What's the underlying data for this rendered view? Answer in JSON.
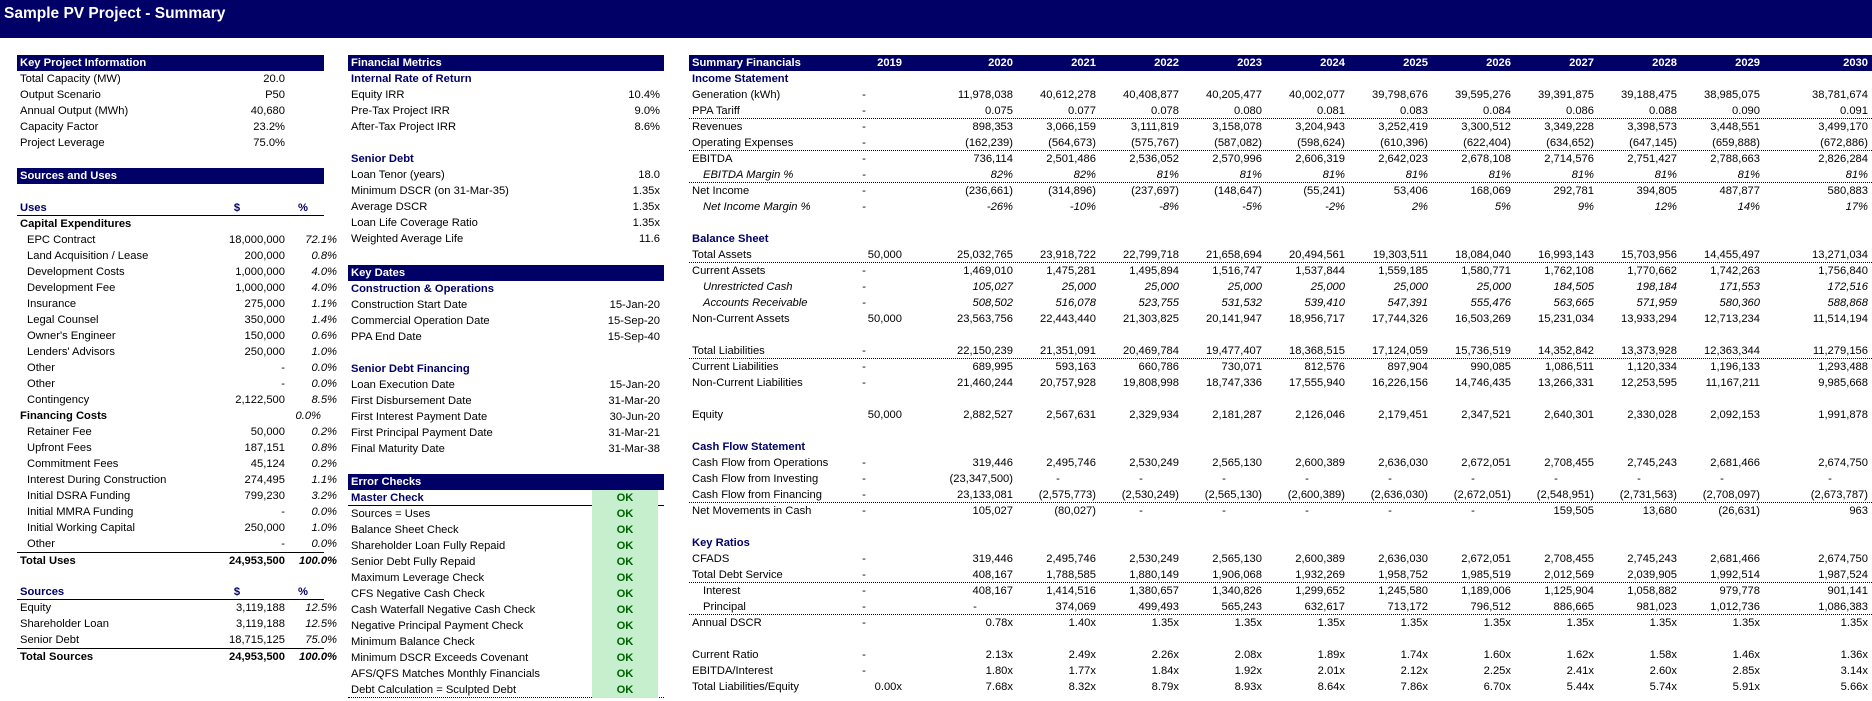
{
  "page_title": "Sample PV Project - Summary",
  "key_info": {
    "header": "Key Project Information",
    "rows": [
      {
        "label": "Total Capacity (MW)",
        "value": "20.0"
      },
      {
        "label": "Output Scenario",
        "value": "P50"
      },
      {
        "label": "Annual Output (MWh)",
        "value": "40,680"
      },
      {
        "label": "Capacity Factor",
        "value": "23.2%"
      },
      {
        "label": "Project Leverage",
        "value": "75.0%"
      }
    ]
  },
  "sources_uses": {
    "header": "Sources and Uses",
    "uses_label": "Uses",
    "uses_col1": "$",
    "uses_col2": "%",
    "capex_label": "Capital Expenditures",
    "capex": [
      {
        "label": "EPC Contract",
        "amount": "18,000,000",
        "pct": "72.1%"
      },
      {
        "label": "Land Acquisition / Lease",
        "amount": "200,000",
        "pct": "0.8%"
      },
      {
        "label": "Development Costs",
        "amount": "1,000,000",
        "pct": "4.0%"
      },
      {
        "label": "Development Fee",
        "amount": "1,000,000",
        "pct": "4.0%"
      },
      {
        "label": "Insurance",
        "amount": "275,000",
        "pct": "1.1%"
      },
      {
        "label": "Legal Counsel",
        "amount": "350,000",
        "pct": "1.4%"
      },
      {
        "label": "Owner's Engineer",
        "amount": "150,000",
        "pct": "0.6%"
      },
      {
        "label": "Lenders' Advisors",
        "amount": "250,000",
        "pct": "1.0%"
      },
      {
        "label": "Other",
        "amount": "-",
        "pct": "0.0%"
      },
      {
        "label": "Other",
        "amount": "-",
        "pct": "0.0%"
      },
      {
        "label": "Contingency",
        "amount": "2,122,500",
        "pct": "8.5%"
      }
    ],
    "fin_label": "Financing Costs",
    "fin_pct": "0.0%",
    "fin": [
      {
        "label": "Retainer Fee",
        "amount": "50,000",
        "pct": "0.2%"
      },
      {
        "label": "Upfront Fees",
        "amount": "187,151",
        "pct": "0.8%"
      },
      {
        "label": "Commitment Fees",
        "amount": "45,124",
        "pct": "0.2%"
      },
      {
        "label": "Interest During Construction",
        "amount": "274,495",
        "pct": "1.1%"
      },
      {
        "label": "Initial DSRA Funding",
        "amount": "799,230",
        "pct": "3.2%"
      },
      {
        "label": "Initial MMRA Funding",
        "amount": "-",
        "pct": "0.0%"
      },
      {
        "label": "Initial Working Capital",
        "amount": "250,000",
        "pct": "1.0%"
      },
      {
        "label": "Other",
        "amount": "-",
        "pct": "0.0%"
      }
    ],
    "total_uses": {
      "label": "Total Uses",
      "amount": "24,953,500",
      "pct": "100.0%"
    },
    "sources_label": "Sources",
    "sources_col1": "$",
    "sources_col2": "%",
    "sources": [
      {
        "label": "Equity",
        "amount": "3,119,188",
        "pct": "12.5%"
      },
      {
        "label": "Shareholder Loan",
        "amount": "3,119,188",
        "pct": "12.5%"
      },
      {
        "label": "Senior Debt",
        "amount": "18,715,125",
        "pct": "75.0%"
      }
    ],
    "total_sources": {
      "label": "Total Sources",
      "amount": "24,953,500",
      "pct": "100.0%"
    }
  },
  "financial_metrics": {
    "header": "Financial Metrics",
    "irr_label": "Internal Rate of Return",
    "irr": [
      {
        "label": "Equity IRR",
        "value": "10.4%"
      },
      {
        "label": "Pre-Tax Project IRR",
        "value": "9.0%"
      },
      {
        "label": "After-Tax Project IRR",
        "value": "8.6%"
      }
    ],
    "debt_label": "Senior Debt",
    "debt": [
      {
        "label": "Loan Tenor (years)",
        "value": "18.0"
      },
      {
        "label": "Minimum DSCR (on 31-Mar-35)",
        "value": "1.35x"
      },
      {
        "label": "Average DSCR",
        "value": "1.35x"
      },
      {
        "label": "Loan Life Coverage Ratio",
        "value": "1.35x"
      },
      {
        "label": "Weighted Average Life",
        "value": "11.6"
      }
    ]
  },
  "key_dates": {
    "header": "Key Dates",
    "construction_label": "Construction & Operations",
    "construction": [
      {
        "label": "Construction Start Date",
        "value": "15-Jan-20"
      },
      {
        "label": "Commercial Operation Date",
        "value": "15-Sep-20"
      },
      {
        "label": "PPA End Date",
        "value": "15-Sep-40"
      }
    ],
    "financing_label": "Senior Debt Financing",
    "financing": [
      {
        "label": "Loan Execution Date",
        "value": "15-Jan-20"
      },
      {
        "label": "First Disbursement Date",
        "value": "31-Mar-20"
      },
      {
        "label": "First Interest Payment Date",
        "value": "30-Jun-20"
      },
      {
        "label": "First Principal Payment Date",
        "value": "31-Mar-21"
      },
      {
        "label": "Final Maturity Date",
        "value": "31-Mar-38"
      }
    ]
  },
  "error_checks": {
    "header": "Error Checks",
    "master_label": "Master Check",
    "master_status": "OK",
    "checks": [
      {
        "label": "Sources = Uses",
        "status": "OK"
      },
      {
        "label": "Balance Sheet Check",
        "status": "OK"
      },
      {
        "label": "Shareholder Loan Fully Repaid",
        "status": "OK"
      },
      {
        "label": "Senior Debt Fully Repaid",
        "status": "OK"
      },
      {
        "label": "Maximum Leverage Check",
        "status": "OK"
      },
      {
        "label": "CFS Negative Cash Check",
        "status": "OK"
      },
      {
        "label": "Cash Waterfall Negative Cash Check",
        "status": "OK"
      },
      {
        "label": "Negative Principal Payment Check",
        "status": "OK"
      },
      {
        "label": "Minimum Balance Check",
        "status": "OK"
      },
      {
        "label": "Minimum DSCR Exceeds Covenant",
        "status": "OK"
      },
      {
        "label": "AFS/QFS Matches Monthly Financials",
        "status": "OK"
      },
      {
        "label": "Debt Calculation = Sculpted Debt",
        "status": "OK"
      }
    ]
  },
  "summary": {
    "header": "Summary Financials",
    "years": [
      "2019",
      "2020",
      "2021",
      "2022",
      "2023",
      "2024",
      "2025",
      "2026",
      "2027",
      "2028",
      "2029",
      "2030"
    ],
    "rows": [
      {
        "type": "section",
        "label": "Income Statement"
      },
      {
        "label": "Generation (kWh)",
        "vals": [
          "-",
          "11,978,038",
          "40,612,278",
          "40,408,877",
          "40,205,477",
          "40,002,077",
          "39,798,676",
          "39,595,276",
          "39,391,875",
          "39,188,475",
          "38,985,075",
          "38,781,674"
        ]
      },
      {
        "label": "PPA Tariff",
        "line": "dot",
        "vals": [
          "-",
          "0.075",
          "0.077",
          "0.078",
          "0.080",
          "0.081",
          "0.083",
          "0.084",
          "0.086",
          "0.088",
          "0.090",
          "0.091"
        ]
      },
      {
        "label": "Revenues",
        "vals": [
          "-",
          "898,353",
          "3,066,159",
          "3,111,819",
          "3,158,078",
          "3,204,943",
          "3,252,419",
          "3,300,512",
          "3,349,228",
          "3,398,573",
          "3,448,551",
          "3,499,170"
        ]
      },
      {
        "label": "Operating Expenses",
        "line": "dot",
        "vals": [
          "-",
          "(162,239)",
          "(564,673)",
          "(575,767)",
          "(587,082)",
          "(598,624)",
          "(610,396)",
          "(622,404)",
          "(634,652)",
          "(647,145)",
          "(659,888)",
          "(672,886)"
        ]
      },
      {
        "label": "EBITDA",
        "vals": [
          "-",
          "736,114",
          "2,501,486",
          "2,536,052",
          "2,570,996",
          "2,606,319",
          "2,642,023",
          "2,678,108",
          "2,714,576",
          "2,751,427",
          "2,788,663",
          "2,826,284"
        ]
      },
      {
        "label": "EBITDA Margin %",
        "italic": true,
        "indent": true,
        "line": "dot",
        "vals": [
          "-",
          "82%",
          "82%",
          "81%",
          "81%",
          "81%",
          "81%",
          "81%",
          "81%",
          "81%",
          "81%",
          "81%"
        ]
      },
      {
        "label": "Net Income",
        "vals": [
          "-",
          "(236,661)",
          "(314,896)",
          "(237,697)",
          "(148,647)",
          "(55,241)",
          "53,406",
          "168,069",
          "292,781",
          "394,805",
          "487,877",
          "580,883"
        ]
      },
      {
        "label": "Net Income Margin %",
        "italic": true,
        "indent": true,
        "vals": [
          "-",
          "-26%",
          "-10%",
          "-8%",
          "-5%",
          "-2%",
          "2%",
          "5%",
          "9%",
          "12%",
          "14%",
          "17%"
        ]
      },
      {
        "type": "blank"
      },
      {
        "type": "section",
        "label": "Balance Sheet"
      },
      {
        "label": "Total Assets",
        "line": "dot",
        "vals": [
          "50,000",
          "25,032,765",
          "23,918,722",
          "22,799,718",
          "21,658,694",
          "20,494,561",
          "19,303,511",
          "18,084,040",
          "16,993,143",
          "15,703,956",
          "14,455,497",
          "13,271,034"
        ]
      },
      {
        "label": "Current Assets",
        "vals": [
          "-",
          "1,469,010",
          "1,475,281",
          "1,495,894",
          "1,516,747",
          "1,537,844",
          "1,559,185",
          "1,580,771",
          "1,762,108",
          "1,770,662",
          "1,742,263",
          "1,756,840"
        ]
      },
      {
        "label": "Unrestricted Cash",
        "italic": true,
        "indent": true,
        "vals": [
          "-",
          "105,027",
          "25,000",
          "25,000",
          "25,000",
          "25,000",
          "25,000",
          "25,000",
          "184,505",
          "198,184",
          "171,553",
          "172,516"
        ]
      },
      {
        "label": "Accounts Receivable",
        "italic": true,
        "indent": true,
        "vals": [
          "-",
          "508,502",
          "516,078",
          "523,755",
          "531,532",
          "539,410",
          "547,391",
          "555,476",
          "563,665",
          "571,959",
          "580,360",
          "588,868"
        ]
      },
      {
        "label": "Non-Current Assets",
        "vals": [
          "50,000",
          "23,563,756",
          "22,443,440",
          "21,303,825",
          "20,141,947",
          "18,956,717",
          "17,744,326",
          "16,503,269",
          "15,231,034",
          "13,933,294",
          "12,713,234",
          "11,514,194"
        ]
      },
      {
        "type": "blank"
      },
      {
        "label": "Total Liabilities",
        "line": "dot",
        "vals": [
          "-",
          "22,150,239",
          "21,351,091",
          "20,469,784",
          "19,477,407",
          "18,368,515",
          "17,124,059",
          "15,736,519",
          "14,352,842",
          "13,373,928",
          "12,363,344",
          "11,279,156"
        ]
      },
      {
        "label": "Current Liabilities",
        "vals": [
          "-",
          "689,995",
          "593,163",
          "660,786",
          "730,071",
          "812,576",
          "897,904",
          "990,085",
          "1,086,511",
          "1,120,334",
          "1,196,133",
          "1,293,488"
        ]
      },
      {
        "label": "Non-Current Liabilities",
        "vals": [
          "-",
          "21,460,244",
          "20,757,928",
          "19,808,998",
          "18,747,336",
          "17,555,940",
          "16,226,156",
          "14,746,435",
          "13,266,331",
          "12,253,595",
          "11,167,211",
          "9,985,668"
        ]
      },
      {
        "type": "blank"
      },
      {
        "label": "Equity",
        "vals": [
          "50,000",
          "2,882,527",
          "2,567,631",
          "2,329,934",
          "2,181,287",
          "2,126,046",
          "2,179,451",
          "2,347,521",
          "2,640,301",
          "2,330,028",
          "2,092,153",
          "1,991,878"
        ]
      },
      {
        "type": "blank"
      },
      {
        "type": "section",
        "label": "Cash Flow Statement"
      },
      {
        "label": "Cash Flow from Operations",
        "vals": [
          "-",
          "319,446",
          "2,495,746",
          "2,530,249",
          "2,565,130",
          "2,600,389",
          "2,636,030",
          "2,672,051",
          "2,708,455",
          "2,745,243",
          "2,681,466",
          "2,674,750"
        ]
      },
      {
        "label": "Cash Flow from Investing",
        "vals": [
          "-",
          "(23,347,500)",
          "-",
          "-",
          "-",
          "-",
          "-",
          "-",
          "-",
          "-",
          "-",
          "-"
        ]
      },
      {
        "label": "Cash Flow from Financing",
        "line": "dot",
        "vals": [
          "-",
          "23,133,081",
          "(2,575,773)",
          "(2,530,249)",
          "(2,565,130)",
          "(2,600,389)",
          "(2,636,030)",
          "(2,672,051)",
          "(2,548,951)",
          "(2,731,563)",
          "(2,708,097)",
          "(2,673,787)"
        ]
      },
      {
        "label": "Net Movements in Cash",
        "vals": [
          "-",
          "105,027",
          "(80,027)",
          "-",
          "-",
          "-",
          "-",
          "-",
          "159,505",
          "13,680",
          "(26,631)",
          "963"
        ]
      },
      {
        "type": "blank"
      },
      {
        "type": "section",
        "label": "Key Ratios"
      },
      {
        "label": "CFADS",
        "vals": [
          "-",
          "319,446",
          "2,495,746",
          "2,530,249",
          "2,565,130",
          "2,600,389",
          "2,636,030",
          "2,672,051",
          "2,708,455",
          "2,745,243",
          "2,681,466",
          "2,674,750"
        ]
      },
      {
        "label": "Total Debt Service",
        "line": "dot",
        "vals": [
          "-",
          "408,167",
          "1,788,585",
          "1,880,149",
          "1,906,068",
          "1,932,269",
          "1,958,752",
          "1,985,519",
          "2,012,569",
          "2,039,905",
          "1,992,514",
          "1,987,524"
        ]
      },
      {
        "label": "Interest",
        "indent": true,
        "vals": [
          "-",
          "408,167",
          "1,414,516",
          "1,380,657",
          "1,340,826",
          "1,299,652",
          "1,245,580",
          "1,189,006",
          "1,125,904",
          "1,058,882",
          "979,778",
          "901,141"
        ]
      },
      {
        "label": "Principal",
        "indent": true,
        "line": "dot",
        "vals": [
          "-",
          "-",
          "374,069",
          "499,493",
          "565,243",
          "632,617",
          "713,172",
          "796,512",
          "886,665",
          "981,023",
          "1,012,736",
          "1,086,383"
        ]
      },
      {
        "label": "Annual DSCR",
        "vals": [
          "-",
          "0.78x",
          "1.40x",
          "1.35x",
          "1.35x",
          "1.35x",
          "1.35x",
          "1.35x",
          "1.35x",
          "1.35x",
          "1.35x",
          "1.35x"
        ]
      },
      {
        "type": "blank"
      },
      {
        "label": "Current Ratio",
        "vals": [
          "-",
          "2.13x",
          "2.49x",
          "2.26x",
          "2.08x",
          "1.89x",
          "1.74x",
          "1.60x",
          "1.62x",
          "1.58x",
          "1.46x",
          "1.36x"
        ]
      },
      {
        "label": "EBITDA/Interest",
        "vals": [
          "-",
          "1.80x",
          "1.77x",
          "1.84x",
          "1.92x",
          "2.01x",
          "2.12x",
          "2.25x",
          "2.41x",
          "2.60x",
          "2.85x",
          "3.14x"
        ]
      },
      {
        "label": "Total Liabilities/Equity",
        "vals": [
          "0.00x",
          "7.68x",
          "8.32x",
          "8.79x",
          "8.93x",
          "8.64x",
          "7.86x",
          "6.70x",
          "5.44x",
          "5.74x",
          "5.91x",
          "5.66x"
        ]
      }
    ]
  }
}
